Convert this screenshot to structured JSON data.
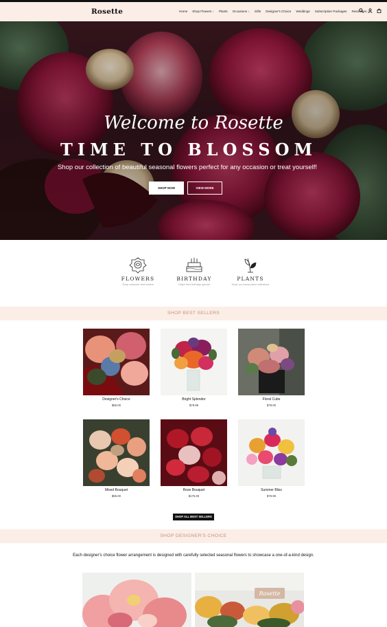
{
  "header": {
    "logo": "Rosette",
    "nav": [
      "Home",
      "Shop Flowers ↓",
      "Plants",
      "Occasions ↓",
      "Gifts",
      "Designer's Choice",
      "Weddings",
      "Subscription Packages",
      "Resources ↓"
    ]
  },
  "hero": {
    "script_title": "Welcome to Rosette",
    "title": "TIME TO BLOSSOM",
    "subtitle": "Shop our collection of beautiful seasonal flowers perfect for any occasion or treat yourself!",
    "shop_now": "SHOP NOW",
    "view_more": "VIEW MORE"
  },
  "categories": [
    {
      "title": "FLOWERS",
      "subtitle": "Shop customer best sellers",
      "icon": "rose-icon"
    },
    {
      "title": "BIRTHDAY",
      "subtitle": "Make their birthday special",
      "icon": "cake-icon"
    },
    {
      "title": "PLANTS",
      "subtitle": "Shop our house plant collections",
      "icon": "plant-icon"
    }
  ],
  "best_sellers": {
    "heading": "SHOP BEST SELLERS",
    "products": [
      {
        "name": "Designer's Choice",
        "price": "$85.00"
      },
      {
        "name": "Bright Splendor",
        "price": "$79.99"
      },
      {
        "name": "Floral Cube",
        "price": "$78.00"
      },
      {
        "name": "Mixed Bouquet",
        "price": "$85.00"
      },
      {
        "name": "Rose Bouquet",
        "price": "$175.00"
      },
      {
        "name": "Summer Bliss",
        "price": "$79.99"
      }
    ],
    "shop_all": "SHOP ALL BEST SELLERS"
  },
  "designers_choice": {
    "heading": "SHOP DESIGNER'S CHOICE",
    "description": "Each designer's choice flower arrangement is designed with carefully selected seasonal flowers to showcase a one-of-a-kind design.",
    "sign_text": "Rosette"
  },
  "colors": {
    "band": "#fbeee7",
    "band_text": "#c6927b",
    "dark": "#111111"
  }
}
